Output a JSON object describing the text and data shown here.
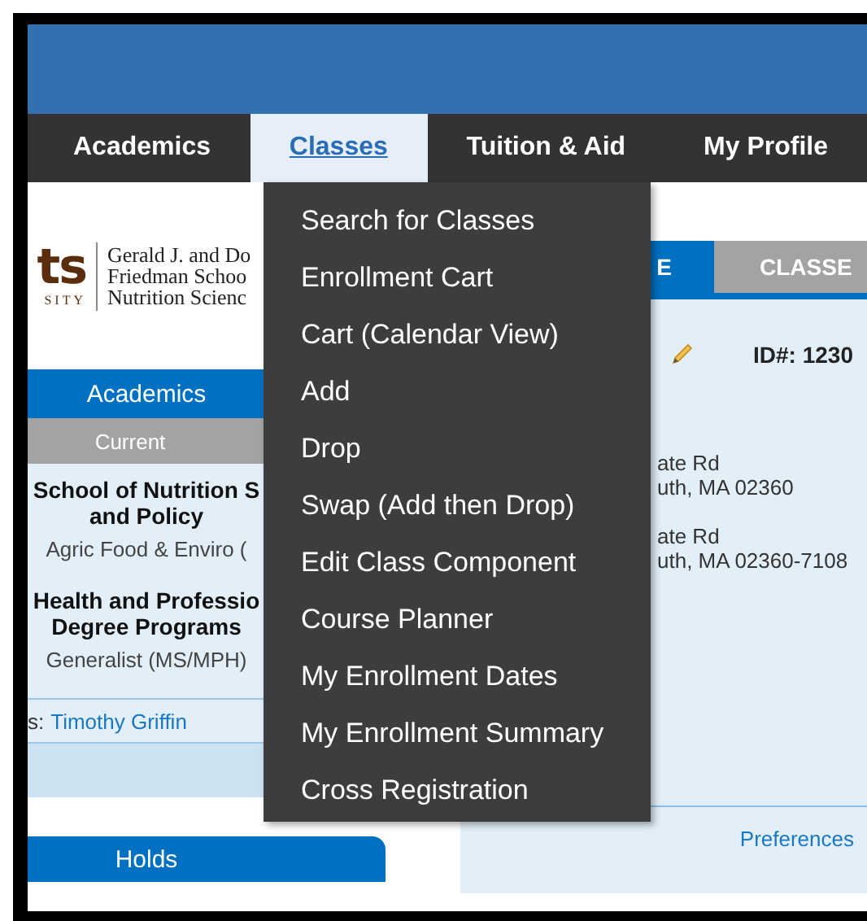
{
  "nav": [
    {
      "label": "Academics",
      "selected": false
    },
    {
      "label": "Classes",
      "selected": true
    },
    {
      "label": "Tuition & Aid",
      "selected": false
    },
    {
      "label": "My Profile",
      "selected": false
    }
  ],
  "menu": [
    "Search for Classes",
    "Enrollment Cart",
    "Cart (Calendar View)",
    "Add",
    "Drop",
    "Swap (Add then Drop)",
    "Edit Class Component",
    "Course Planner",
    "My Enrollment Dates",
    "My Enrollment Summary",
    "Cross Registration"
  ],
  "logo": {
    "mark": "ts",
    "mark_sub": "SITY",
    "lines": [
      "Gerald J. and Do",
      "Friedman Schoo",
      "Nutrition Scienc"
    ]
  },
  "academics_panel": {
    "title": "Academics",
    "subtitle": "Current",
    "programs": [
      {
        "school": [
          "School of Nutrition S",
          "and Policy"
        ],
        "plan": "Agric Food & Enviro ("
      },
      {
        "school": [
          "Health and Professio",
          "Degree Programs"
        ],
        "plan": "Generalist (MS/MPH)"
      }
    ],
    "advisor_label": "s:",
    "advisor": "Timothy Griffin"
  },
  "holds_panel": {
    "title": "Holds"
  },
  "profile_panel": {
    "tabs": [
      {
        "label": "E",
        "selected": true
      },
      {
        "label": "CLASSE",
        "selected": false
      }
    ],
    "id": "ID#: 1230",
    "addresses": [
      [
        "ate Rd",
        "uth, MA 02360"
      ],
      [
        "ate Rd",
        "uth, MA 02360-7108"
      ]
    ],
    "link": "Preferences"
  }
}
